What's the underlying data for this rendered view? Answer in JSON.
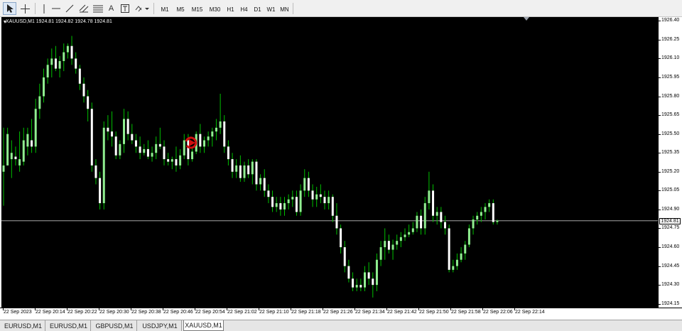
{
  "toolbar": {
    "tools": [
      {
        "icon": "cursor-icon"
      },
      {
        "icon": "crosshair-icon"
      },
      {
        "icon": "vertical-line-icon"
      },
      {
        "icon": "horizontal-line-icon"
      },
      {
        "icon": "trendline-icon"
      },
      {
        "icon": "channel-icon"
      },
      {
        "icon": "fibonacci-icon"
      },
      {
        "icon": "text-icon",
        "glyph": "A"
      },
      {
        "icon": "text-label-icon",
        "glyph": "T"
      },
      {
        "icon": "shapes-icon"
      }
    ],
    "timeframes": [
      "M1",
      "M5",
      "M15",
      "M30",
      "H1",
      "H4",
      "D1",
      "W1",
      "MN"
    ]
  },
  "chart": {
    "info": "XAUUSD,M1  1924.81 1924.82 1924.78 1924.81",
    "current_price": "1924.81",
    "colors": {
      "background": "#000000",
      "bull": "#90ee90",
      "bear": "#ffffff",
      "wick": "#00c000",
      "line": "#c0c0c0",
      "arrow": "#d01010"
    },
    "price_labels": [
      "1926.40",
      "1926.25",
      "1926.10",
      "1925.95",
      "1925.80",
      "1925.65",
      "1925.50",
      "1925.35",
      "1925.20",
      "1925.05",
      "1924.90",
      "1924.75",
      "1924.60",
      "1924.45",
      "1924.30",
      "1924.15"
    ],
    "time_labels": [
      "22 Sep 2023",
      "22 Sep 20:14",
      "22 Sep 20:22",
      "22 Sep 20:30",
      "22 Sep 20:38",
      "22 Sep 20:46",
      "22 Sep 20:54",
      "22 Sep 21:02",
      "22 Sep 21:10",
      "22 Sep 21:18",
      "22 Sep 21:26",
      "22 Sep 21:34",
      "22 Sep 21:42",
      "22 Sep 21:50",
      "22 Sep 21:58",
      "22 Sep 22:06",
      "22 Sep 22:14"
    ]
  },
  "chart_data": {
    "type": "candlestick",
    "symbol": "XAUUSD",
    "timeframe": "M1",
    "start_time": "22 Sep 20:06",
    "interval_minutes": 1,
    "ylim": [
      1924.12,
      1926.43
    ],
    "current_price": 1924.81,
    "candles": [
      [
        1925.2,
        1925.55,
        1924.93,
        1925.25
      ],
      [
        1925.25,
        1925.55,
        1925.25,
        1925.5
      ],
      [
        1925.3,
        1925.45,
        1925.15,
        1925.35
      ],
      [
        1925.32,
        1925.4,
        1925.25,
        1925.3
      ],
      [
        1925.25,
        1925.52,
        1925.2,
        1925.3
      ],
      [
        1925.28,
        1925.55,
        1925.25,
        1925.45
      ],
      [
        1925.4,
        1925.55,
        1925.33,
        1925.5
      ],
      [
        1925.45,
        1925.62,
        1925.35,
        1925.4
      ],
      [
        1925.4,
        1925.78,
        1925.35,
        1925.7
      ],
      [
        1925.7,
        1925.9,
        1925.62,
        1925.8
      ],
      [
        1925.8,
        1926.02,
        1925.75,
        1925.95
      ],
      [
        1925.95,
        1926.1,
        1925.9,
        1926.05
      ],
      [
        1926.05,
        1926.18,
        1925.95,
        1926.1
      ],
      [
        1926.1,
        1926.2,
        1926.0,
        1926.02
      ],
      [
        1926.02,
        1926.12,
        1925.95,
        1926.08
      ],
      [
        1926.08,
        1926.22,
        1926.0,
        1926.15
      ],
      [
        1926.15,
        1926.22,
        1926.1,
        1926.2
      ],
      [
        1926.2,
        1926.28,
        1926.05,
        1926.1
      ],
      [
        1926.1,
        1926.15,
        1925.98,
        1926.02
      ],
      [
        1926.02,
        1926.05,
        1925.85,
        1925.9
      ],
      [
        1925.9,
        1925.95,
        1925.75,
        1925.8
      ],
      [
        1925.8,
        1925.85,
        1925.6,
        1925.7
      ],
      [
        1925.7,
        1925.75,
        1925.2,
        1925.25
      ],
      [
        1925.25,
        1925.3,
        1925.1,
        1925.15
      ],
      [
        1925.15,
        1925.2,
        1924.9,
        1924.95
      ],
      [
        1924.95,
        1925.6,
        1924.9,
        1925.55
      ],
      [
        1925.55,
        1925.65,
        1925.45,
        1925.52
      ],
      [
        1925.52,
        1925.68,
        1925.4,
        1925.48
      ],
      [
        1925.48,
        1925.52,
        1925.3,
        1925.33
      ],
      [
        1925.33,
        1925.45,
        1925.3,
        1925.42
      ],
      [
        1925.42,
        1925.7,
        1925.35,
        1925.62
      ],
      [
        1925.62,
        1925.68,
        1925.45,
        1925.5
      ],
      [
        1925.5,
        1925.58,
        1925.42,
        1925.45
      ],
      [
        1925.45,
        1925.5,
        1925.35,
        1925.4
      ],
      [
        1925.4,
        1925.48,
        1925.3,
        1925.35
      ],
      [
        1925.35,
        1925.42,
        1925.33,
        1925.38
      ],
      [
        1925.38,
        1925.45,
        1925.3,
        1925.32
      ],
      [
        1925.32,
        1925.4,
        1925.28,
        1925.35
      ],
      [
        1925.35,
        1925.48,
        1925.3,
        1925.42
      ],
      [
        1925.42,
        1925.55,
        1925.38,
        1925.4
      ],
      [
        1925.4,
        1925.45,
        1925.25,
        1925.3
      ],
      [
        1925.3,
        1925.35,
        1925.25,
        1925.28
      ],
      [
        1925.28,
        1925.32,
        1925.22,
        1925.3
      ],
      [
        1925.3,
        1925.4,
        1925.2,
        1925.25
      ],
      [
        1925.25,
        1925.38,
        1925.22,
        1925.33
      ],
      [
        1925.33,
        1925.5,
        1925.3,
        1925.45
      ],
      [
        1925.45,
        1925.5,
        1925.25,
        1925.3
      ],
      [
        1925.3,
        1925.4,
        1925.28,
        1925.36
      ],
      [
        1925.36,
        1925.52,
        1925.34,
        1925.5
      ],
      [
        1925.5,
        1925.58,
        1925.35,
        1925.4
      ],
      [
        1925.4,
        1925.48,
        1925.35,
        1925.45
      ],
      [
        1925.45,
        1925.52,
        1925.4,
        1925.48
      ],
      [
        1925.48,
        1925.55,
        1925.4,
        1925.52
      ],
      [
        1925.52,
        1925.62,
        1925.45,
        1925.55
      ],
      [
        1925.55,
        1925.82,
        1925.5,
        1925.6
      ],
      [
        1925.6,
        1925.65,
        1925.35,
        1925.4
      ],
      [
        1925.4,
        1925.45,
        1925.25,
        1925.3
      ],
      [
        1925.3,
        1925.35,
        1925.15,
        1925.2
      ],
      [
        1925.2,
        1925.3,
        1925.15,
        1925.25
      ],
      [
        1925.25,
        1925.33,
        1925.12,
        1925.15
      ],
      [
        1925.15,
        1925.28,
        1925.12,
        1925.25
      ],
      [
        1925.25,
        1925.3,
        1925.15,
        1925.18
      ],
      [
        1925.18,
        1925.3,
        1925.1,
        1925.28
      ],
      [
        1925.28,
        1925.3,
        1925.05,
        1925.1
      ],
      [
        1925.1,
        1925.18,
        1925.05,
        1925.15
      ],
      [
        1925.15,
        1925.22,
        1925.0,
        1925.05
      ],
      [
        1925.05,
        1925.1,
        1924.95,
        1925.0
      ],
      [
        1925.0,
        1925.05,
        1924.88,
        1924.92
      ],
      [
        1924.92,
        1925.0,
        1924.88,
        1924.95
      ],
      [
        1924.95,
        1925.0,
        1924.85,
        1924.9
      ],
      [
        1924.9,
        1925.0,
        1924.85,
        1924.95
      ],
      [
        1924.95,
        1925.02,
        1924.9,
        1924.98
      ],
      [
        1924.98,
        1925.05,
        1924.92,
        1925.0
      ],
      [
        1925.0,
        1925.05,
        1924.85,
        1924.88
      ],
      [
        1924.88,
        1925.1,
        1924.85,
        1925.05
      ],
      [
        1925.05,
        1925.22,
        1925.0,
        1925.15
      ],
      [
        1925.15,
        1925.2,
        1925.0,
        1925.05
      ],
      [
        1925.05,
        1925.1,
        1924.92,
        1924.98
      ],
      [
        1924.98,
        1925.08,
        1924.92,
        1925.02
      ],
      [
        1925.02,
        1925.1,
        1924.95,
        1925.0
      ],
      [
        1925.0,
        1925.05,
        1924.9,
        1924.95
      ],
      [
        1924.95,
        1925.05,
        1924.9,
        1925.0
      ],
      [
        1925.0,
        1925.02,
        1924.8,
        1924.85
      ],
      [
        1924.85,
        1924.95,
        1924.7,
        1924.75
      ],
      [
        1924.75,
        1924.78,
        1924.55,
        1924.6
      ],
      [
        1924.6,
        1924.65,
        1924.4,
        1924.45
      ],
      [
        1924.45,
        1924.5,
        1924.32,
        1924.35
      ],
      [
        1924.35,
        1924.4,
        1924.25,
        1924.28
      ],
      [
        1924.28,
        1924.35,
        1924.25,
        1924.3
      ],
      [
        1924.3,
        1924.35,
        1924.25,
        1924.28
      ],
      [
        1924.28,
        1924.45,
        1924.25,
        1924.4
      ],
      [
        1924.4,
        1924.48,
        1924.3,
        1924.35
      ],
      [
        1924.35,
        1924.4,
        1924.2,
        1924.3
      ],
      [
        1924.3,
        1924.55,
        1924.25,
        1924.5
      ],
      [
        1924.5,
        1924.65,
        1924.45,
        1924.6
      ],
      [
        1924.6,
        1924.75,
        1924.5,
        1924.65
      ],
      [
        1924.65,
        1924.7,
        1924.55,
        1924.58
      ],
      [
        1924.58,
        1924.66,
        1924.5,
        1924.62
      ],
      [
        1924.62,
        1924.7,
        1924.58,
        1924.65
      ],
      [
        1924.65,
        1924.72,
        1924.6,
        1924.68
      ],
      [
        1924.68,
        1924.75,
        1924.65,
        1924.7
      ],
      [
        1924.7,
        1924.78,
        1924.68,
        1924.72
      ],
      [
        1924.72,
        1924.8,
        1924.7,
        1924.75
      ],
      [
        1924.75,
        1924.88,
        1924.72,
        1924.85
      ],
      [
        1924.85,
        1924.9,
        1924.7,
        1924.75
      ],
      [
        1924.75,
        1925.0,
        1924.7,
        1924.95
      ],
      [
        1924.95,
        1925.2,
        1924.9,
        1925.05
      ],
      [
        1925.05,
        1925.1,
        1924.8,
        1924.85
      ],
      [
        1924.85,
        1924.92,
        1924.78,
        1924.88
      ],
      [
        1924.88,
        1924.92,
        1924.75,
        1924.8
      ],
      [
        1924.8,
        1924.85,
        1924.7,
        1924.75
      ],
      [
        1924.75,
        1924.78,
        1924.4,
        1924.42
      ],
      [
        1924.42,
        1924.5,
        1924.4,
        1924.45
      ],
      [
        1924.45,
        1924.55,
        1924.42,
        1924.5
      ],
      [
        1924.5,
        1924.6,
        1924.48,
        1924.55
      ],
      [
        1924.55,
        1924.65,
        1924.5,
        1924.62
      ],
      [
        1924.62,
        1924.78,
        1924.6,
        1924.75
      ],
      [
        1924.75,
        1924.85,
        1924.7,
        1924.82
      ],
      [
        1924.82,
        1924.88,
        1924.78,
        1924.85
      ],
      [
        1924.85,
        1924.92,
        1924.8,
        1924.88
      ],
      [
        1924.88,
        1924.95,
        1924.82,
        1924.92
      ],
      [
        1924.92,
        1924.98,
        1924.88,
        1924.95
      ],
      [
        1924.95,
        1924.98,
        1924.78,
        1924.8
      ],
      [
        1924.8,
        1924.82,
        1924.78,
        1924.81
      ]
    ]
  },
  "tabs": [
    {
      "label": "EURUSD,M1",
      "active": false
    },
    {
      "label": "EURUSD,M1",
      "active": false
    },
    {
      "label": "GBPUSD,M1",
      "active": false
    },
    {
      "label": "USDJPY,M1",
      "active": false
    },
    {
      "label": "XAUUSD,M1",
      "active": true
    }
  ]
}
